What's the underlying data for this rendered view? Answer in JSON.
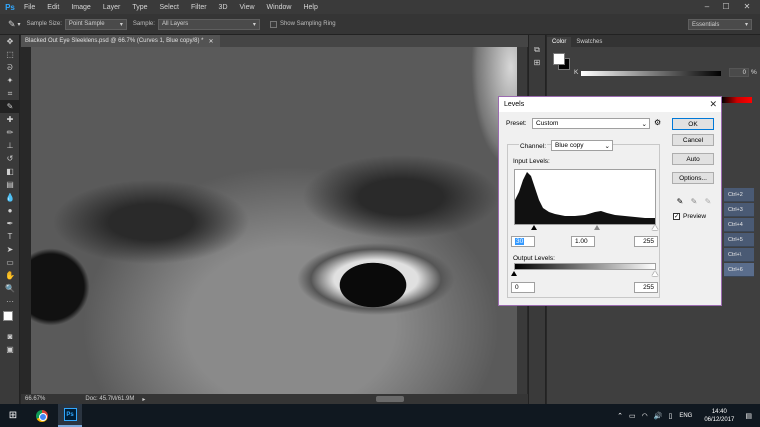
{
  "app": {
    "logo": "Ps",
    "menu": [
      "File",
      "Edit",
      "Image",
      "Layer",
      "Type",
      "Select",
      "Filter",
      "3D",
      "View",
      "Window",
      "Help"
    ]
  },
  "options": {
    "sample_size_label": "Sample Size:",
    "sample_size_value": "Point Sample",
    "sample_label": "Sample:",
    "sample_value": "All Layers",
    "show_ring_label": "Show Sampling Ring",
    "workspace": "Essentials"
  },
  "document": {
    "tab_title": "Blacked Out Eye Sleeklens.psd @ 66.7% (Curves 1, Blue copy/8) *",
    "zoom": "66.67%",
    "doc_size": "Doc: 45.7M/61.9M"
  },
  "panels": {
    "color_tab": "Color",
    "swatches_tab": "Swatches",
    "k_label": "K",
    "k_value": "0",
    "k_unit": "%",
    "shortcuts": [
      "Ctrl+2",
      "Ctrl+3",
      "Ctrl+4",
      "Ctrl+5",
      "Ctrl+\\",
      "Ctrl+6"
    ]
  },
  "levels": {
    "title": "Levels",
    "preset_label": "Preset:",
    "preset_value": "Custom",
    "channel_label": "Channel:",
    "channel_value": "Blue copy",
    "input_label": "Input Levels:",
    "input_black": "30",
    "input_gamma": "1.00",
    "input_white": "255",
    "output_label": "Output Levels:",
    "output_black": "0",
    "output_white": "255",
    "ok": "OK",
    "cancel": "Cancel",
    "auto": "Auto",
    "options": "Options...",
    "preview_label": "Preview",
    "preview_checked": true
  },
  "taskbar": {
    "language": "ENG",
    "time": "14:40",
    "date": "06/12/2017"
  },
  "colors": {
    "dialog_border": "#9b6bb0",
    "ps_blue": "#31a8ff",
    "selected_shortcut": "#4a5a74"
  }
}
